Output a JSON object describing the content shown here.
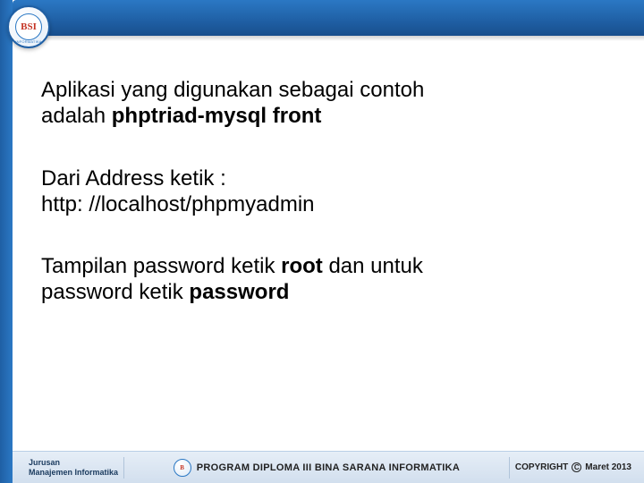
{
  "logo": {
    "initials": "BSI",
    "subtext": "INFORMATIKA"
  },
  "content": {
    "p1_l1": "Aplikasi yang digunakan sebagai contoh",
    "p1_l2_a": "adalah ",
    "p1_l2_b": "phptriad-mysql front",
    "p2_l1": "Dari Address ketik :",
    "p2_l2": "http: //localhost/phpmyadmin",
    "p3_l1_a": "Tampilan password ketik ",
    "p3_l1_b": "root",
    "p3_l1_c": " dan untuk",
    "p3_l2_a": "password ketik ",
    "p3_l2_b": "password"
  },
  "footer": {
    "left_l1": "Jurusan",
    "left_l2": "Manajemen Informatika",
    "center": "PROGRAM DIPLOMA III BINA SARANA INFORMATIKA",
    "right_prefix": "COPYRIGHT",
    "right_symbol": "C",
    "right_year": "Maret 2013"
  }
}
